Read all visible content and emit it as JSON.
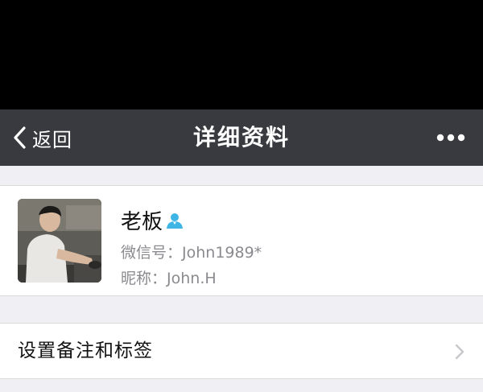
{
  "navbar": {
    "back_label": "返回",
    "title": "详细资料",
    "more_icon": "more-dots-icon",
    "background": "#393a3f"
  },
  "profile": {
    "name": "老板",
    "gender_icon": "person-icon",
    "gender_icon_color": "#3fb5e5",
    "wechat_id_label": "微信号：",
    "wechat_id": "John1989*",
    "nickname_label": "昵称：",
    "nickname": "John.H"
  },
  "remark_row": {
    "label": "设置备注和标签",
    "chevron_icon": "chevron-right-icon"
  },
  "colors": {
    "page_background": "#efeff4",
    "card_background": "#ffffff",
    "secondary_text": "#8a8a8f"
  }
}
